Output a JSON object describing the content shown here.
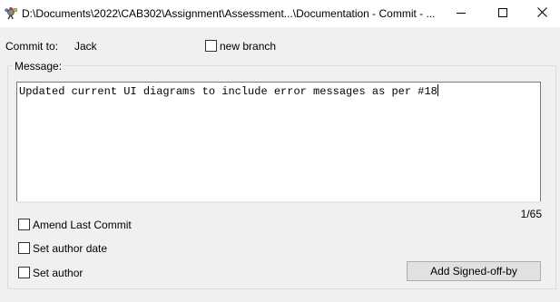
{
  "window": {
    "title": "D:\\Documents\\2022\\CAB302\\Assignment\\Assessment...\\Documentation - Commit - ...",
    "app_icon": "git-commit-app-icon",
    "controls": {
      "minimize_icon": "minimize-icon",
      "maximize_icon": "maximize-icon",
      "close_icon": "close-icon"
    }
  },
  "commit_to": {
    "label": "Commit to:",
    "branch": "Jack"
  },
  "new_branch": {
    "label": "new branch",
    "checked": false
  },
  "message": {
    "group_label": "Message:",
    "text": "Updated current UI diagrams to include error messages as per #18",
    "counter": "1/65"
  },
  "options": {
    "amend_last_commit": {
      "label": "Amend Last Commit",
      "checked": false
    },
    "set_author_date": {
      "label": "Set author date",
      "checked": false
    },
    "set_author": {
      "label": "Set author",
      "checked": false
    }
  },
  "buttons": {
    "add_signed_off_by": "Add Signed-off-by"
  },
  "colors": {
    "dialog_background": "#f0f0f0",
    "titlebar_background": "#ffffff",
    "button_background": "#e1e1e1",
    "button_border": "#adadad"
  }
}
